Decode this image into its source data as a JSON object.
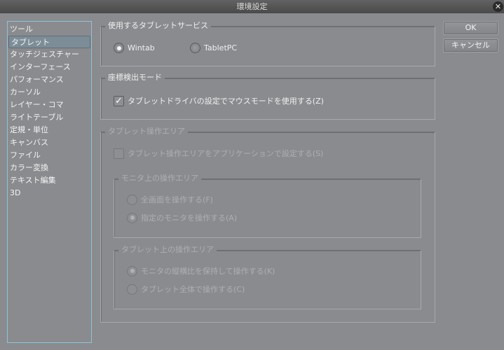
{
  "window": {
    "title": "環境設定",
    "close_icon": "close-icon"
  },
  "sidebar": {
    "items": [
      {
        "label": "ツール"
      },
      {
        "label": "タブレット",
        "selected": true
      },
      {
        "label": "タッチジェスチャー"
      },
      {
        "label": "インターフェース"
      },
      {
        "label": "パフォーマンス"
      },
      {
        "label": "カーソル"
      },
      {
        "label": "レイヤー・コマ"
      },
      {
        "label": "ライトテーブル"
      },
      {
        "label": "定規・単位"
      },
      {
        "label": "キャンバス"
      },
      {
        "label": "ファイル"
      },
      {
        "label": "カラー変換"
      },
      {
        "label": "テキスト編集"
      },
      {
        "label": "3D"
      }
    ]
  },
  "service": {
    "title": "使用するタブレットサービス",
    "options": [
      {
        "label": "Wintab",
        "checked": true
      },
      {
        "label": "TabletPC",
        "checked": false
      }
    ]
  },
  "coord": {
    "title": "座標検出モード",
    "checkbox": {
      "label": "タブレットドライバの設定でマウスモードを使用する(Z)",
      "checked": true
    }
  },
  "area": {
    "title": "タブレット操作エリア",
    "checkbox": {
      "label": "タブレット操作エリアをアプリケーションで設定する(S)",
      "checked": false
    },
    "monitor": {
      "title": "モニタ上の操作エリア",
      "options": [
        {
          "label": "全画面を操作する(F)",
          "checked": false
        },
        {
          "label": "指定のモニタを操作する(A)",
          "checked": true
        }
      ]
    },
    "tablet": {
      "title": "タブレット上の操作エリア",
      "options": [
        {
          "label": "モニタの縦横比を保持して操作する(K)",
          "checked": true
        },
        {
          "label": "タブレット全体で操作する(C)",
          "checked": false
        }
      ]
    }
  },
  "buttons": {
    "ok": "OK",
    "cancel": "キャンセル"
  }
}
